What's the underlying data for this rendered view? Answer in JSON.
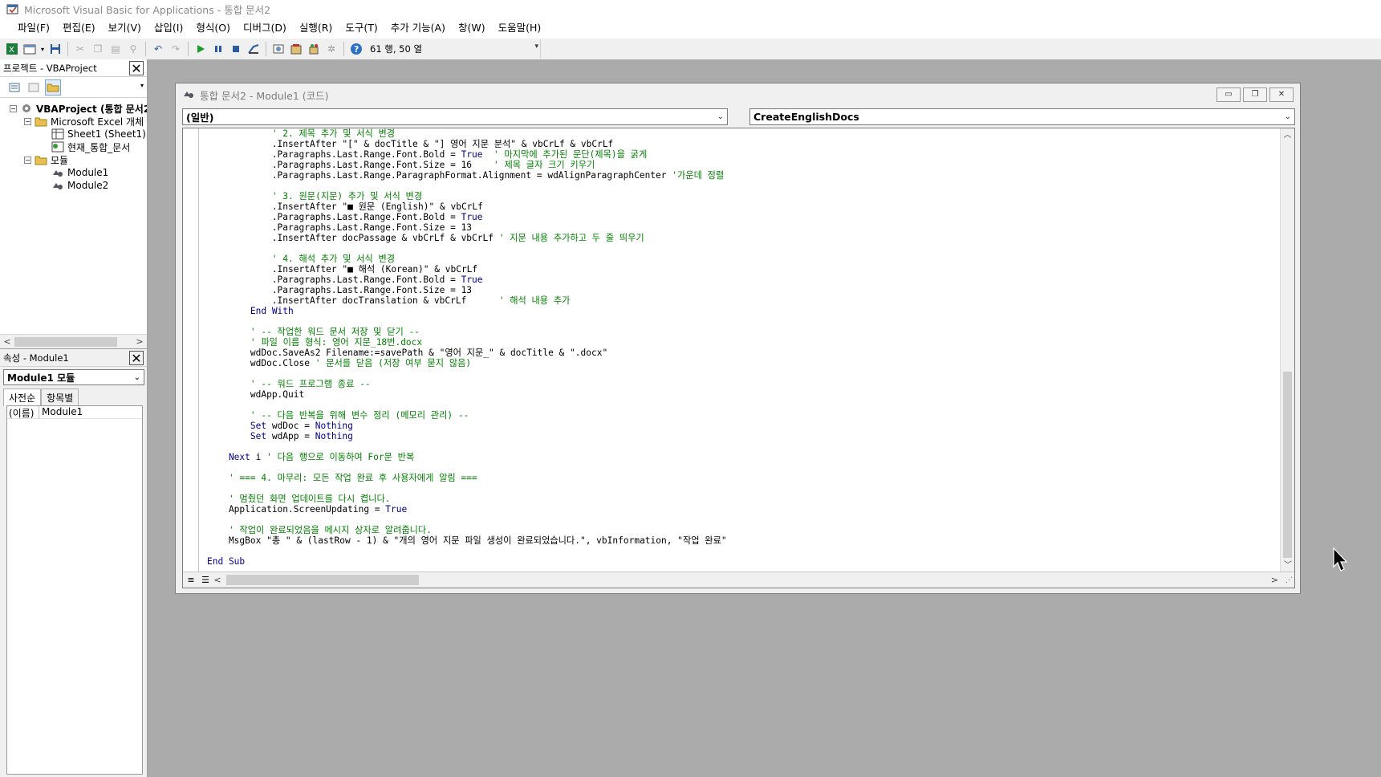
{
  "window": {
    "title": "Microsoft Visual Basic for Applications - 통합 문서2"
  },
  "menu": [
    {
      "label": "파일(F)"
    },
    {
      "label": "편집(E)"
    },
    {
      "label": "보기(V)"
    },
    {
      "label": "삽입(I)"
    },
    {
      "label": "형식(O)"
    },
    {
      "label": "디버그(D)"
    },
    {
      "label": "실행(R)"
    },
    {
      "label": "도구(T)"
    },
    {
      "label": "추가 기능(A)"
    },
    {
      "label": "창(W)"
    },
    {
      "label": "도움말(H)"
    }
  ],
  "toolbar": {
    "status": "61 행, 50 열"
  },
  "project_pane": {
    "title": "프로젝트 - VBAProject",
    "tree": [
      {
        "label": "VBAProject (통합 문서2)",
        "bold": true
      },
      {
        "label": "Microsoft Excel 개체"
      },
      {
        "label": "Sheet1 (Sheet1)"
      },
      {
        "label": "현재_통합_문서"
      },
      {
        "label": "모듈"
      },
      {
        "label": "Module1"
      },
      {
        "label": "Module2"
      }
    ]
  },
  "properties_pane": {
    "title": "속성 - Module1",
    "selected_object": "Module1 모듈",
    "tabs": [
      {
        "label": "사전순"
      },
      {
        "label": "항목별"
      }
    ],
    "rows": [
      {
        "name": "(이름)",
        "value": "Module1"
      }
    ]
  },
  "code_window": {
    "title": "통합 문서2 - Module1 (코드)",
    "object_combo": "(일반)",
    "procedure_combo": "CreateEnglishDocs",
    "lines": [
      [
        [
          "cm",
          "            ' 2. 제목 추가 및 서식 변경"
        ]
      ],
      [
        [
          "",
          "            .InsertAfter \"[\" & docTitle & \"] 영어 지문 분석\" & vbCrLf & vbCrLf"
        ]
      ],
      [
        [
          "",
          "            .Paragraphs.Last.Range.Font.Bold = "
        ],
        [
          "kw",
          "True"
        ],
        [
          "cm",
          "  ' 마지막에 추가된 문단(제목)을 굵게"
        ]
      ],
      [
        [
          "",
          "            .Paragraphs.Last.Range.Font.Size = 16    "
        ],
        [
          "cm",
          "' 제목 글자 크기 키우기"
        ]
      ],
      [
        [
          "",
          "            .Paragraphs.Last.Range.ParagraphFormat.Alignment = wdAlignParagraphCenter "
        ],
        [
          "cm",
          "'가운데 정렬"
        ]
      ],
      [
        [
          "",
          ""
        ]
      ],
      [
        [
          "cm",
          "            ' 3. 원문(지문) 추가 및 서식 변경"
        ]
      ],
      [
        [
          "",
          "            .InsertAfter \"■ 원문 (English)\" & vbCrLf"
        ]
      ],
      [
        [
          "",
          "            .Paragraphs.Last.Range.Font.Bold = "
        ],
        [
          "kw",
          "True"
        ]
      ],
      [
        [
          "",
          "            .Paragraphs.Last.Range.Font.Size = 13"
        ]
      ],
      [
        [
          "",
          "            .InsertAfter docPassage & vbCrLf & vbCrLf "
        ],
        [
          "cm",
          "' 지문 내용 추가하고 두 줄 띄우기"
        ]
      ],
      [
        [
          "",
          ""
        ]
      ],
      [
        [
          "cm",
          "            ' 4. 해석 추가 및 서식 변경"
        ]
      ],
      [
        [
          "",
          "            .InsertAfter \"■ 해석 (Korean)\" & vbCrLf"
        ]
      ],
      [
        [
          "",
          "            .Paragraphs.Last.Range.Font.Bold = "
        ],
        [
          "kw",
          "True"
        ]
      ],
      [
        [
          "",
          "            .Paragraphs.Last.Range.Font.Size = 13"
        ]
      ],
      [
        [
          "",
          "            .InsertAfter docTranslation & vbCrLf      "
        ],
        [
          "cm",
          "' 해석 내용 추가"
        ]
      ],
      [
        [
          "kw",
          "        End With"
        ]
      ],
      [
        [
          "",
          ""
        ]
      ],
      [
        [
          "cm",
          "        ' -- 작업한 워드 문서 저장 및 닫기 --"
        ]
      ],
      [
        [
          "cm",
          "        ' 파일 이름 형식: 영어 지문_18번.docx"
        ]
      ],
      [
        [
          "",
          "        wdDoc.SaveAs2 Filename:=savePath & \"영어 지문_\" & docTitle & \".docx\""
        ]
      ],
      [
        [
          "",
          "        wdDoc.Close "
        ],
        [
          "cm",
          "' 문서를 닫음 (저장 여부 묻지 않음)"
        ]
      ],
      [
        [
          "",
          ""
        ]
      ],
      [
        [
          "cm",
          "        ' -- 워드 프로그램 종료 --"
        ]
      ],
      [
        [
          "",
          "        wdApp.Quit"
        ]
      ],
      [
        [
          "",
          ""
        ]
      ],
      [
        [
          "cm",
          "        ' -- 다음 반복을 위해 변수 정리 (메모리 관리) --"
        ]
      ],
      [
        [
          "kw",
          "        Set"
        ],
        [
          "",
          " wdDoc = "
        ],
        [
          "kw",
          "Nothing"
        ]
      ],
      [
        [
          "kw",
          "        Set"
        ],
        [
          "",
          " wdApp = "
        ],
        [
          "kw",
          "Nothing"
        ]
      ],
      [
        [
          "",
          ""
        ]
      ],
      [
        [
          "kw",
          "    Next"
        ],
        [
          "",
          " i "
        ],
        [
          "cm",
          "' 다음 행으로 이동하여 For문 반복"
        ]
      ],
      [
        [
          "",
          ""
        ]
      ],
      [
        [
          "cm",
          "    ' === 4. 마무리: 모든 작업 완료 후 사용자에게 알림 ==="
        ]
      ],
      [
        [
          "",
          ""
        ]
      ],
      [
        [
          "cm",
          "    ' 멈췄던 화면 업데이트를 다시 켭니다."
        ]
      ],
      [
        [
          "",
          "    Application.ScreenUpdating = "
        ],
        [
          "kw",
          "True"
        ]
      ],
      [
        [
          "",
          ""
        ]
      ],
      [
        [
          "cm",
          "    ' 작업이 완료되었음을 메시지 상자로 알려줍니다."
        ]
      ],
      [
        [
          "",
          "    MsgBox \"총 \" & (lastRow - 1) & \"개의 영어 지문 파일 생성이 완료되었습니다.\", vbInformation, \"작업 완료\""
        ]
      ],
      [
        [
          "",
          ""
        ]
      ],
      [
        [
          "kw",
          "End Sub"
        ]
      ]
    ]
  },
  "colors": {
    "keyword": "#00008b",
    "comment": "#007f00",
    "mdi_background": "#ababab"
  }
}
